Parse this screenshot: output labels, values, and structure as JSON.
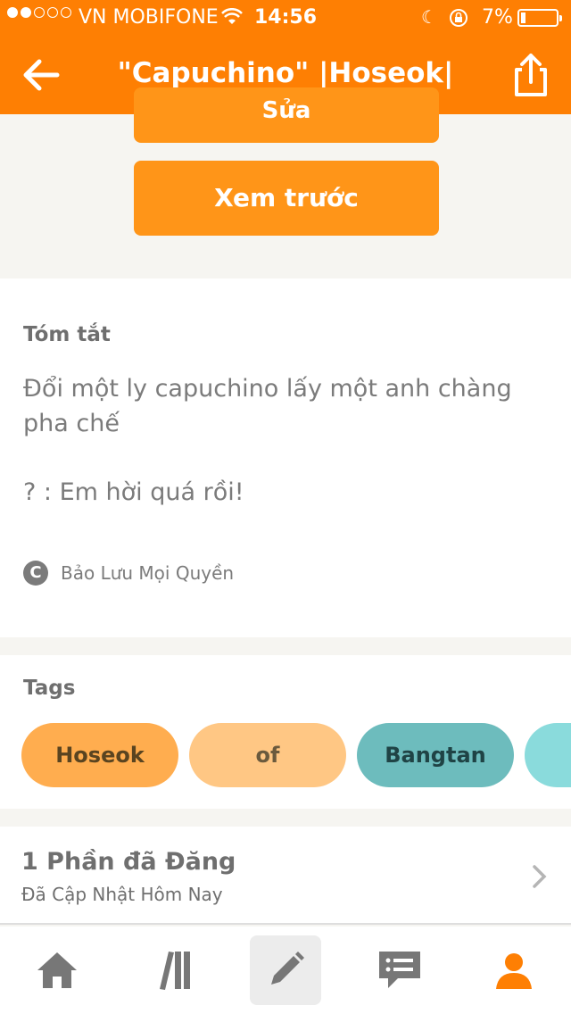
{
  "status_bar": {
    "carrier": "VN MOBIFONE",
    "time": "14:56",
    "battery": "7%"
  },
  "nav": {
    "title": "\"Capuchino\" |Hoseok|"
  },
  "actions": {
    "edit_label": "Sửa",
    "preview_label": "Xem trước"
  },
  "summary": {
    "heading": "Tóm tắt",
    "text": "Đổi một ly capuchino lấy một anh chàng pha chế",
    "text2": "? : Em hời quá rồi!",
    "copyright": "Bảo Lưu Mọi Quyền"
  },
  "tags": {
    "heading": "Tags",
    "items": [
      "Hoseok",
      "of",
      "Bangtan",
      ""
    ]
  },
  "parts": {
    "title": "1 Phần đã Đăng",
    "subtitle": "Đã Cập Nhật Hôm Nay"
  },
  "colors": {
    "brand": "#fe7f03",
    "button": "#ff9518",
    "tag1": "#ffad4f",
    "tag2": "#ffc784",
    "tag3": "#6dbcbd",
    "tag4": "#8adbdc"
  },
  "tab_bar": [
    "home-icon",
    "library-icon",
    "write-icon",
    "messages-icon",
    "profile-icon"
  ]
}
